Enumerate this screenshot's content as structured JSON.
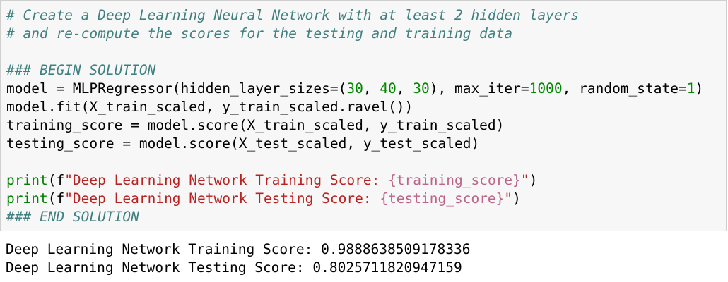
{
  "code": {
    "comment1": "# Create a Deep Learning Neural Network with at least 2 hidden layers",
    "comment2": "# and re-compute the scores for the testing and training data",
    "begin_marker": "### BEGIN SOLUTION",
    "model_line": {
      "prefix": "model = MLPRegressor(hidden_layer_sizes=(",
      "n1": "30",
      "sep1": ", ",
      "n2": "40",
      "sep2": ", ",
      "n3": "30",
      "mid": "), max_iter=",
      "n4": "1000",
      "mid2": ", random_state=",
      "n5": "1",
      "suffix": ")"
    },
    "fit_line": "model.fit(X_train_scaled, y_train_scaled.ravel())",
    "train_score_line": "training_score = model.score(X_train_scaled, y_train_scaled)",
    "test_score_line": "testing_score = model.score(X_test_scaled, y_test_scaled)",
    "print1": {
      "func": "print",
      "open": "(f",
      "str_start": "\"Deep Learning Network Training Score: ",
      "interp": "{training_score}",
      "str_end": "\"",
      "close": ")"
    },
    "print2": {
      "func": "print",
      "open": "(f",
      "str_start": "\"Deep Learning Network Testing Score: ",
      "interp": "{testing_score}",
      "str_end": "\"",
      "close": ")"
    },
    "end_marker": "### END SOLUTION"
  },
  "output": {
    "line1": "Deep Learning Network Training Score: 0.9888638509178336",
    "line2": "Deep Learning Network Testing Score: 0.8025711820947159"
  },
  "colors": {
    "comment": "#408080",
    "number": "#008800",
    "string": "#ba2121",
    "cell_background": "#f7f7f7",
    "cell_border": "#cfcfcf"
  }
}
